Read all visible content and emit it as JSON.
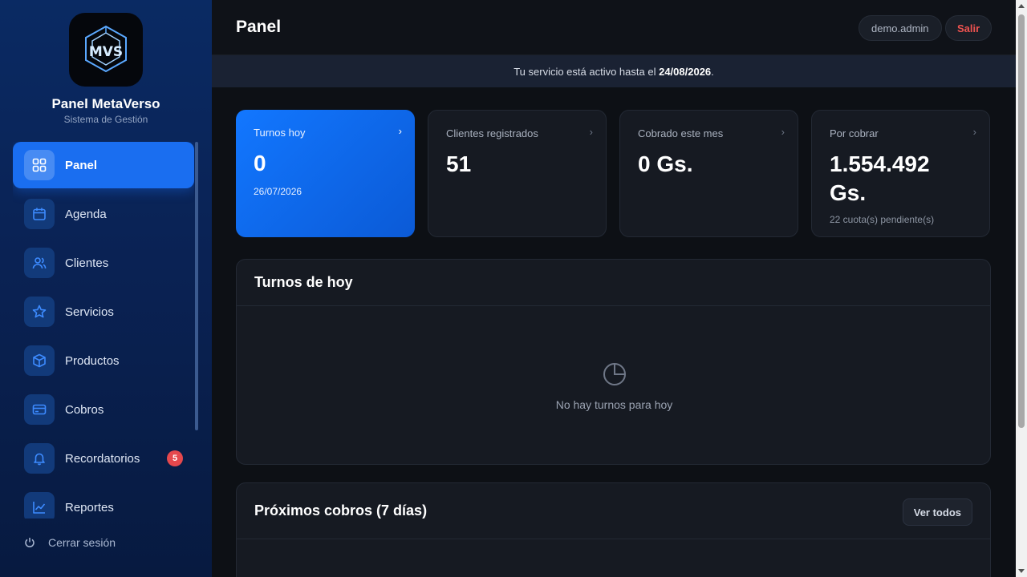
{
  "brand": {
    "logo_text": "MVS",
    "title": "Panel MetaVerso",
    "subtitle": "Sistema de Gestión"
  },
  "nav": {
    "items": [
      {
        "label": "Panel",
        "icon": "grid-icon",
        "active": true
      },
      {
        "label": "Agenda",
        "icon": "calendar-icon"
      },
      {
        "label": "Clientes",
        "icon": "users-icon"
      },
      {
        "label": "Servicios",
        "icon": "star-icon"
      },
      {
        "label": "Productos",
        "icon": "box-icon"
      },
      {
        "label": "Cobros",
        "icon": "credit-card-icon"
      },
      {
        "label": "Recordatorios",
        "icon": "bell-icon",
        "badge": "5"
      },
      {
        "label": "Reportes",
        "icon": "chart-line-icon"
      }
    ],
    "logout_label": "Cerrar sesión"
  },
  "header": {
    "title": "Panel",
    "user": "demo.admin",
    "logout": "Salir"
  },
  "banner": {
    "text_before": "Tu servicio está activo hasta el ",
    "date": "24/08/2026",
    "text_after": "."
  },
  "stats": [
    {
      "label": "Turnos hoy",
      "value": "0",
      "sub": "26/07/2026"
    },
    {
      "label": "Clientes registrados",
      "value": "51",
      "sub": ""
    },
    {
      "label": "Cobrado este mes",
      "value": "0 Gs.",
      "sub": ""
    },
    {
      "label": "Por cobrar",
      "value": "1.554.492 Gs.",
      "sub": "22 cuota(s) pendiente(s)"
    }
  ],
  "today_panel": {
    "title": "Turnos de hoy",
    "empty_text": "No hay turnos para hoy"
  },
  "upcoming_panel": {
    "title": "Próximos cobros (7 días)",
    "button": "Ver todos"
  },
  "colors": {
    "accent": "#1277ff",
    "danger": "#ef5350",
    "sidebar": "#0a2a63",
    "background": "#0d1015"
  }
}
